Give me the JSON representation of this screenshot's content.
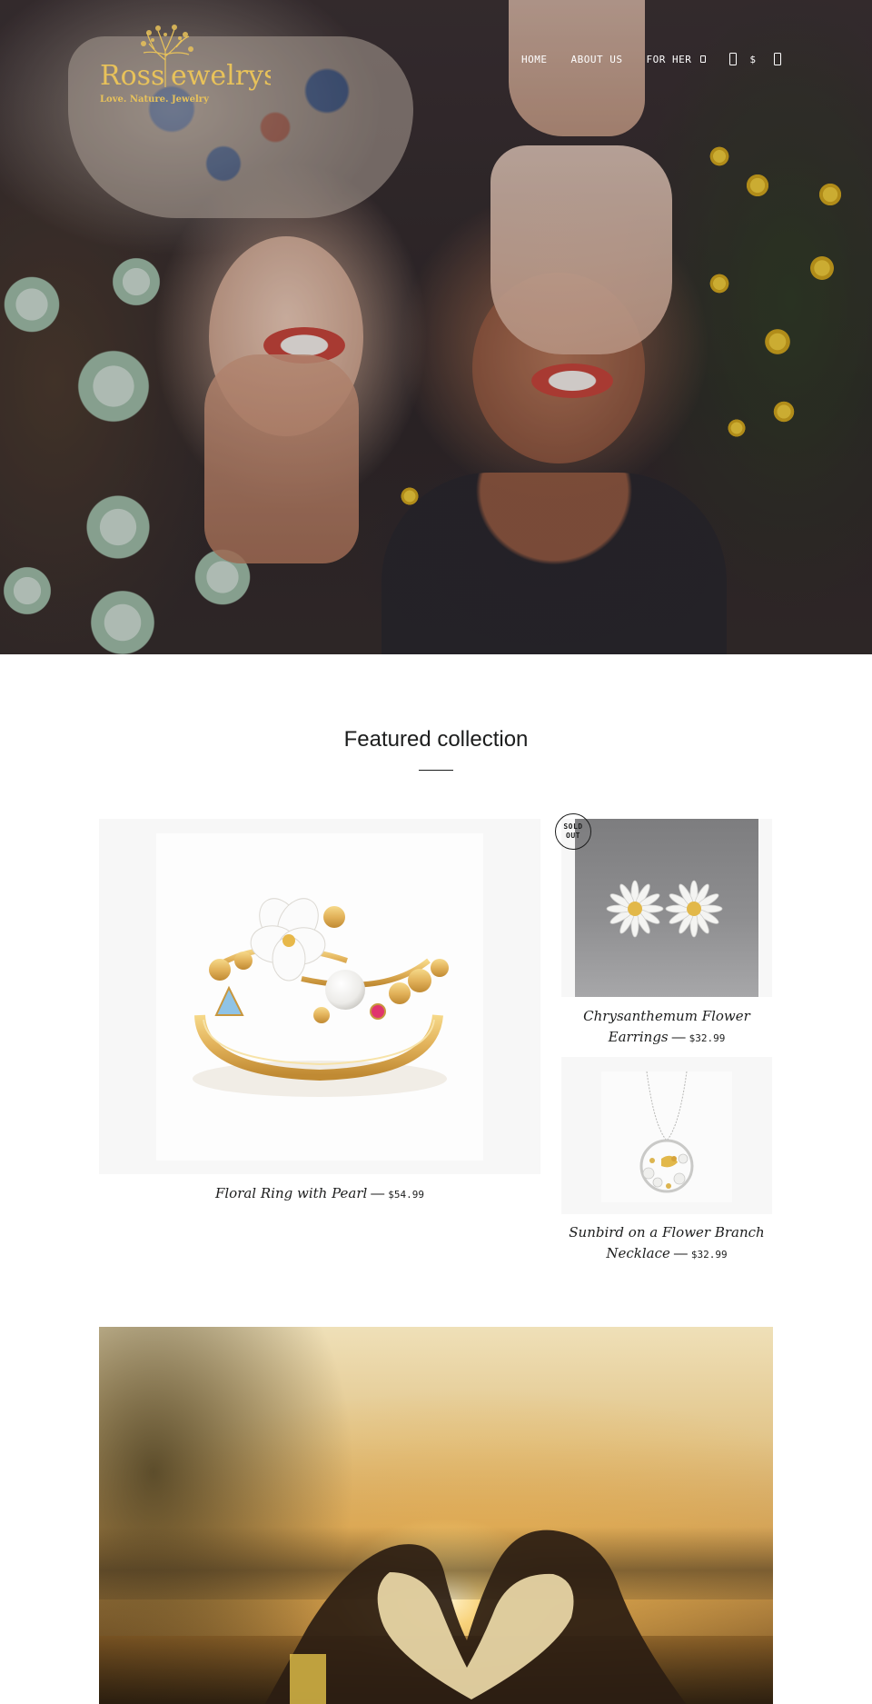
{
  "brand": {
    "name": "Ross Jewelrys",
    "tagline": "Love. Nature. Jewelry"
  },
  "nav": {
    "items": [
      {
        "label": "HOME"
      },
      {
        "label": "ABOUT US"
      },
      {
        "label": "FOR HER"
      }
    ],
    "currency": "$",
    "icons": [
      "chevron-down-icon",
      "user-icon",
      "cart-icon"
    ]
  },
  "featured": {
    "title": "Featured collection",
    "products": [
      {
        "name": "Floral Ring with Pearl",
        "separator": "—",
        "price": "$54.99"
      },
      {
        "name": "Chrysanthemum Flower Earrings",
        "separator": "—",
        "price": "$32.99",
        "badge": "SOLD OUT"
      },
      {
        "name": "Sunbird on a Flower Branch Necklace",
        "separator": "—",
        "price": "$32.99"
      }
    ]
  },
  "colors": {
    "text": "#1c1d1d",
    "brand_gold": "#e8c25a",
    "card_bg": "#f7f7f7",
    "page_bg": "#ffffff"
  }
}
